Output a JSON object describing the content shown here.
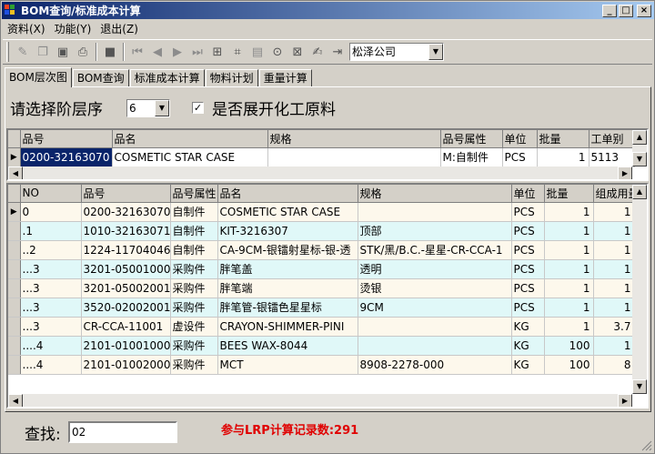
{
  "window": {
    "title": "BOM查询/标准成本计算",
    "buttons": {
      "minimize": "_",
      "maximize": "□",
      "close": "×"
    }
  },
  "menu": [
    "资料(X)",
    "功能(Y)",
    "退出(Z)"
  ],
  "toolbar": {
    "company": "松泽公司"
  },
  "tabs": [
    "BOM层次图",
    "BOM查询",
    "标准成本计算",
    "物料计划",
    "重量计算"
  ],
  "filter": {
    "level_label": "请选择阶层序",
    "level_value": "6",
    "expand_label": "是否展开化工原料",
    "expand_checked": "✓"
  },
  "top_grid": {
    "headers": [
      "品号",
      "品名",
      "规格",
      "品号属性",
      "单位",
      "批量",
      "工单别"
    ],
    "row": {
      "code": "0200-32163070",
      "name": "COSMETIC STAR CASE",
      "spec": "",
      "attr": "M:自制件",
      "unit": "PCS",
      "qty": "1",
      "order": "5113"
    }
  },
  "bottom_grid": {
    "headers": [
      "NO",
      "品号",
      "品号属性",
      "品名",
      "规格",
      "单位",
      "批量",
      "组成用量"
    ],
    "rows": [
      {
        "no": "0",
        "code": "0200-32163070",
        "attr": "自制件",
        "name": "COSMETIC STAR CASE",
        "spec": "",
        "unit": "PCS",
        "qty": "1",
        "usage": "1"
      },
      {
        "no": ".1",
        "code": "1010-32163071",
        "attr": "自制件",
        "name": "KIT-3216307",
        "spec": "顶部",
        "unit": "PCS",
        "qty": "1",
        "usage": "1"
      },
      {
        "no": "..2",
        "code": "1224-11704046",
        "attr": "自制件",
        "name": "CA-9CM-银镭射星标-银-透",
        "spec": "STK/黑/B.C.-星星-CR-CCA-1",
        "unit": "PCS",
        "qty": "1",
        "usage": "1"
      },
      {
        "no": "...3",
        "code": "3201-05001000",
        "attr": "采购件",
        "name": "胖笔盖",
        "spec": "透明",
        "unit": "PCS",
        "qty": "1",
        "usage": "1"
      },
      {
        "no": "...3",
        "code": "3201-05002001",
        "attr": "采购件",
        "name": "胖笔端",
        "spec": "烫银",
        "unit": "PCS",
        "qty": "1",
        "usage": "1"
      },
      {
        "no": "...3",
        "code": "3520-02002001",
        "attr": "采购件",
        "name": "胖笔管-银镭色星星标",
        "spec": "9CM",
        "unit": "PCS",
        "qty": "1",
        "usage": "1"
      },
      {
        "no": "...3",
        "code": "CR-CCA-11001",
        "attr": "虚设件",
        "name": "CRAYON-SHIMMER-PINI",
        "spec": "",
        "unit": "KG",
        "qty": "1",
        "usage": "3.7"
      },
      {
        "no": "....4",
        "code": "2101-01001000",
        "attr": "采购件",
        "name": "BEES WAX-8044",
        "spec": "",
        "unit": "KG",
        "qty": "100",
        "usage": "1"
      },
      {
        "no": "....4",
        "code": "2101-01002000",
        "attr": "采购件",
        "name": "MCT",
        "spec": "8908-2278-000",
        "unit": "KG",
        "qty": "100",
        "usage": "8"
      }
    ]
  },
  "search": {
    "label": "查找:",
    "value": "02"
  },
  "status": "参与LRP计算记录数:291"
}
